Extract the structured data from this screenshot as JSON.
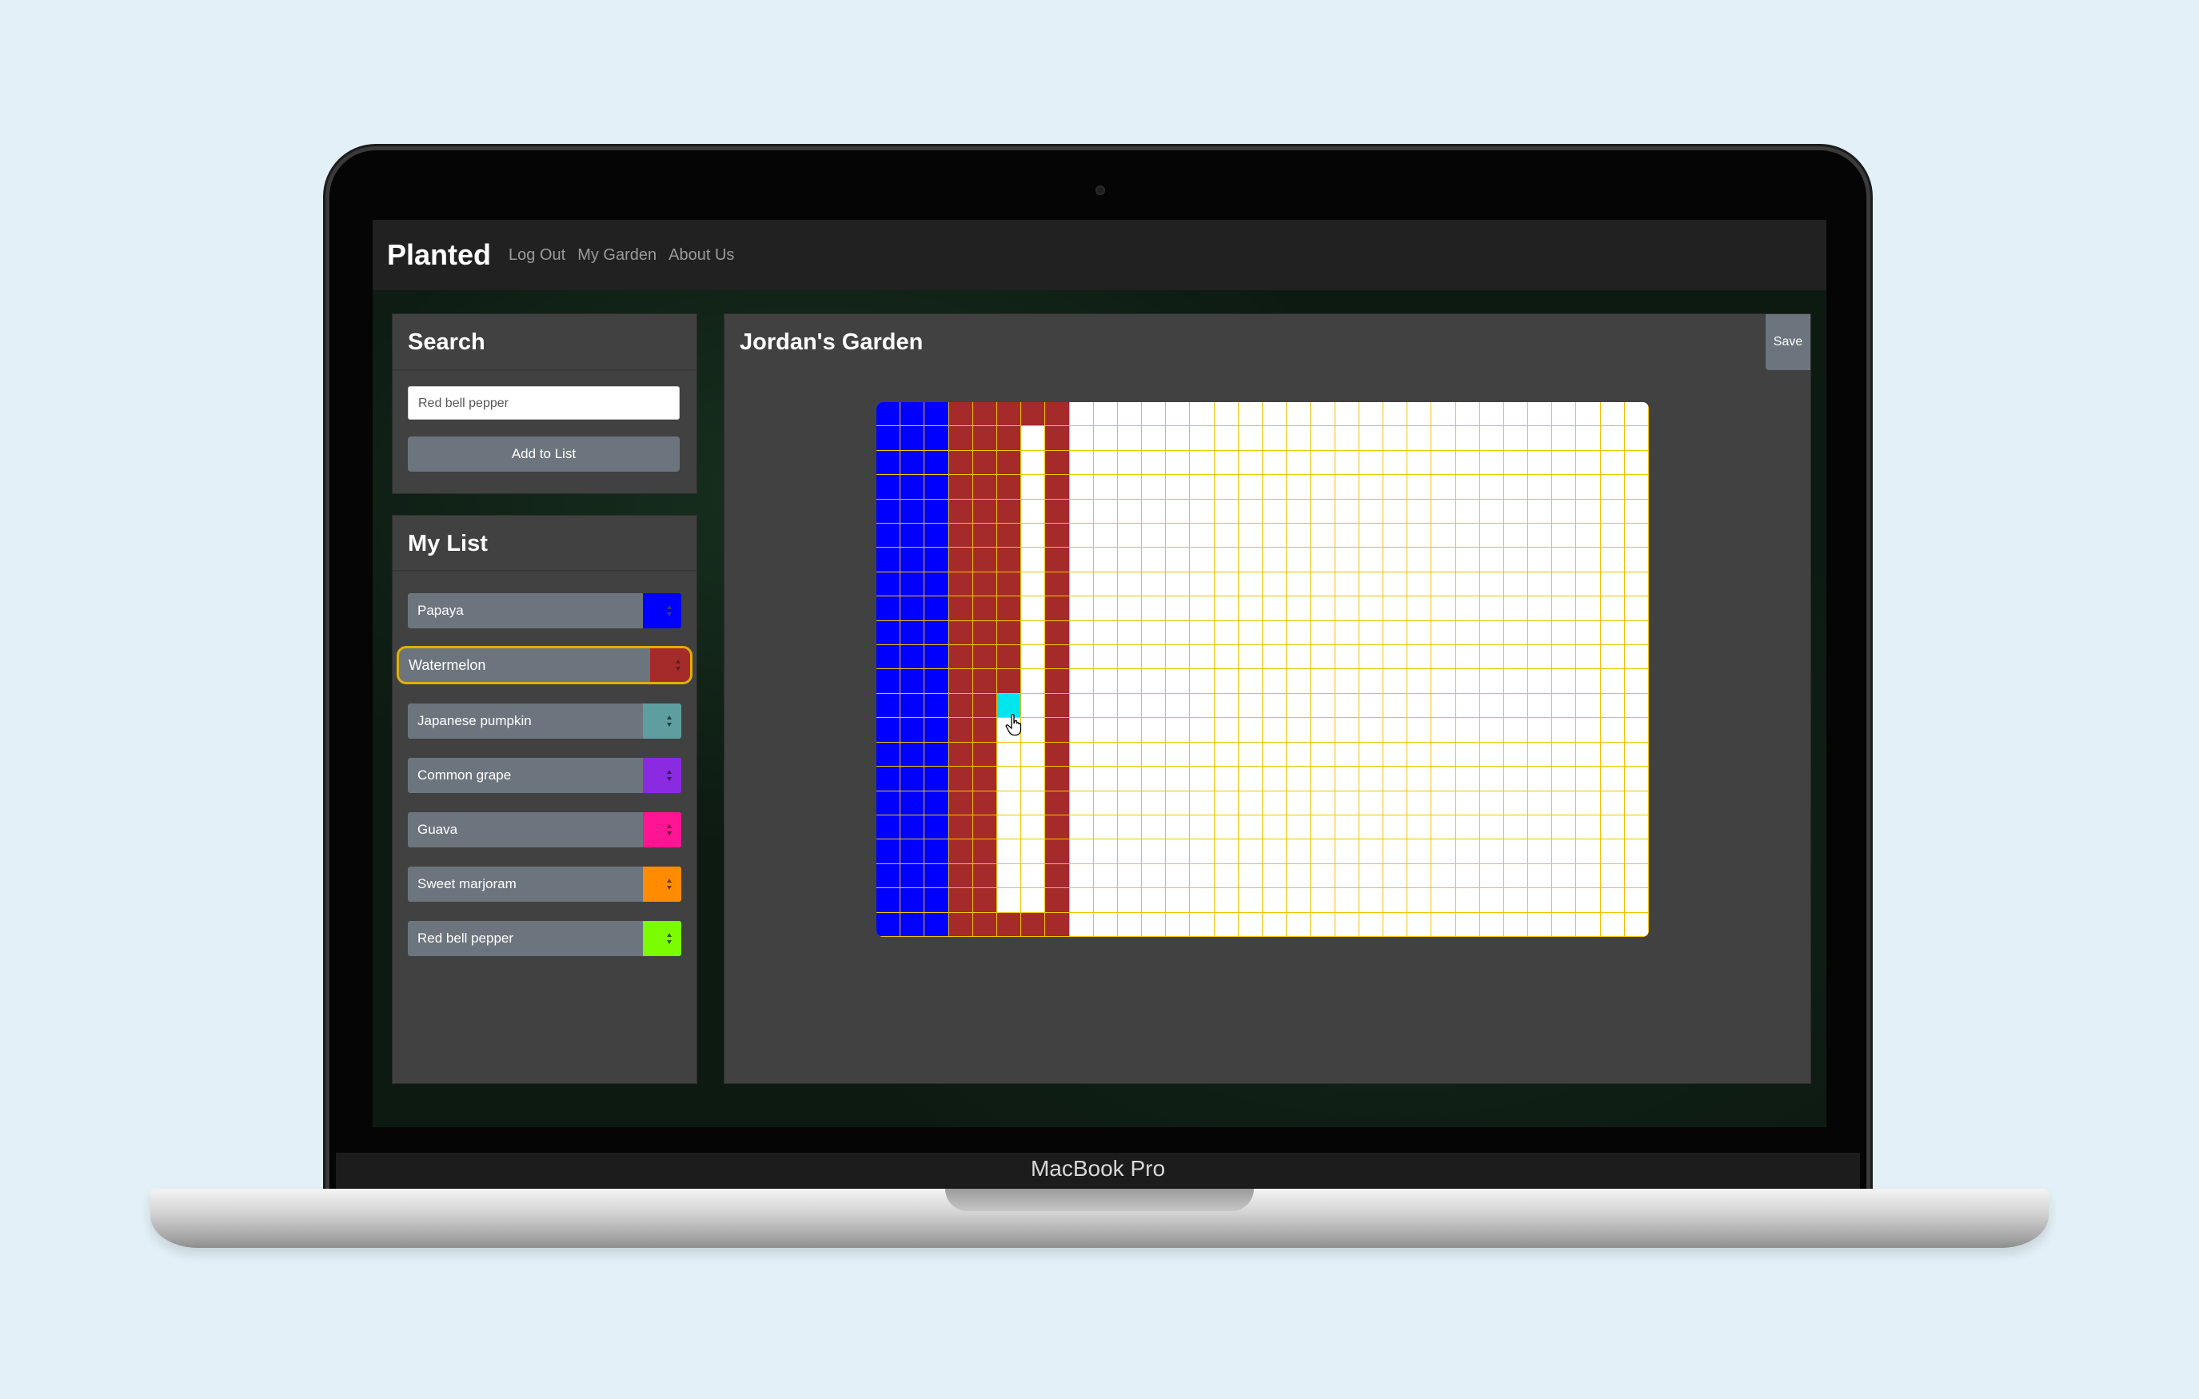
{
  "device": {
    "label": "MacBook Pro"
  },
  "navbar": {
    "brand": "Planted",
    "links": [
      "Log Out",
      "My Garden",
      "About Us"
    ]
  },
  "search": {
    "title": "Search",
    "input_value": "Red bell pepper",
    "add_button": "Add to List"
  },
  "my_list": {
    "title": "My List",
    "items": [
      {
        "name": "Papaya",
        "color": "#0000ff"
      },
      {
        "name": "Watermelon",
        "color": "#a52a2a",
        "selected": true
      },
      {
        "name": "Japanese pumpkin",
        "color": "#5f9ea0"
      },
      {
        "name": "Common grape",
        "color": "#8a2be2"
      },
      {
        "name": "Guava",
        "color": "#ff1493"
      },
      {
        "name": "Sweet marjoram",
        "color": "#ff8c00"
      },
      {
        "name": "Red bell pepper",
        "color": "#7cfc00"
      }
    ]
  },
  "garden": {
    "title": "Jordan's Garden",
    "save_button": "Save",
    "grid_columns": 32,
    "grid_rows": 22,
    "grid_line_color": "#f0c400",
    "empty_color": "#ffffff",
    "hover_color": "#00e5ee",
    "columns": [
      {
        "col_start": 0,
        "col_end": 2,
        "row_start": 0,
        "row_end": 21,
        "plant": "Papaya",
        "color": "#0000ff"
      },
      {
        "col_start": 3,
        "col_end": 7,
        "row_start": 0,
        "row_end": 21,
        "plant": "Watermelon",
        "color": "#a52a2a"
      }
    ],
    "cleared": [
      {
        "col_start": 6,
        "col_end": 6,
        "row_start": 1,
        "row_end": 20
      },
      {
        "col_start": 5,
        "col_end": 5,
        "row_start": 13,
        "row_end": 20
      }
    ],
    "hover_cell": {
      "col": 5,
      "row": 12
    }
  }
}
